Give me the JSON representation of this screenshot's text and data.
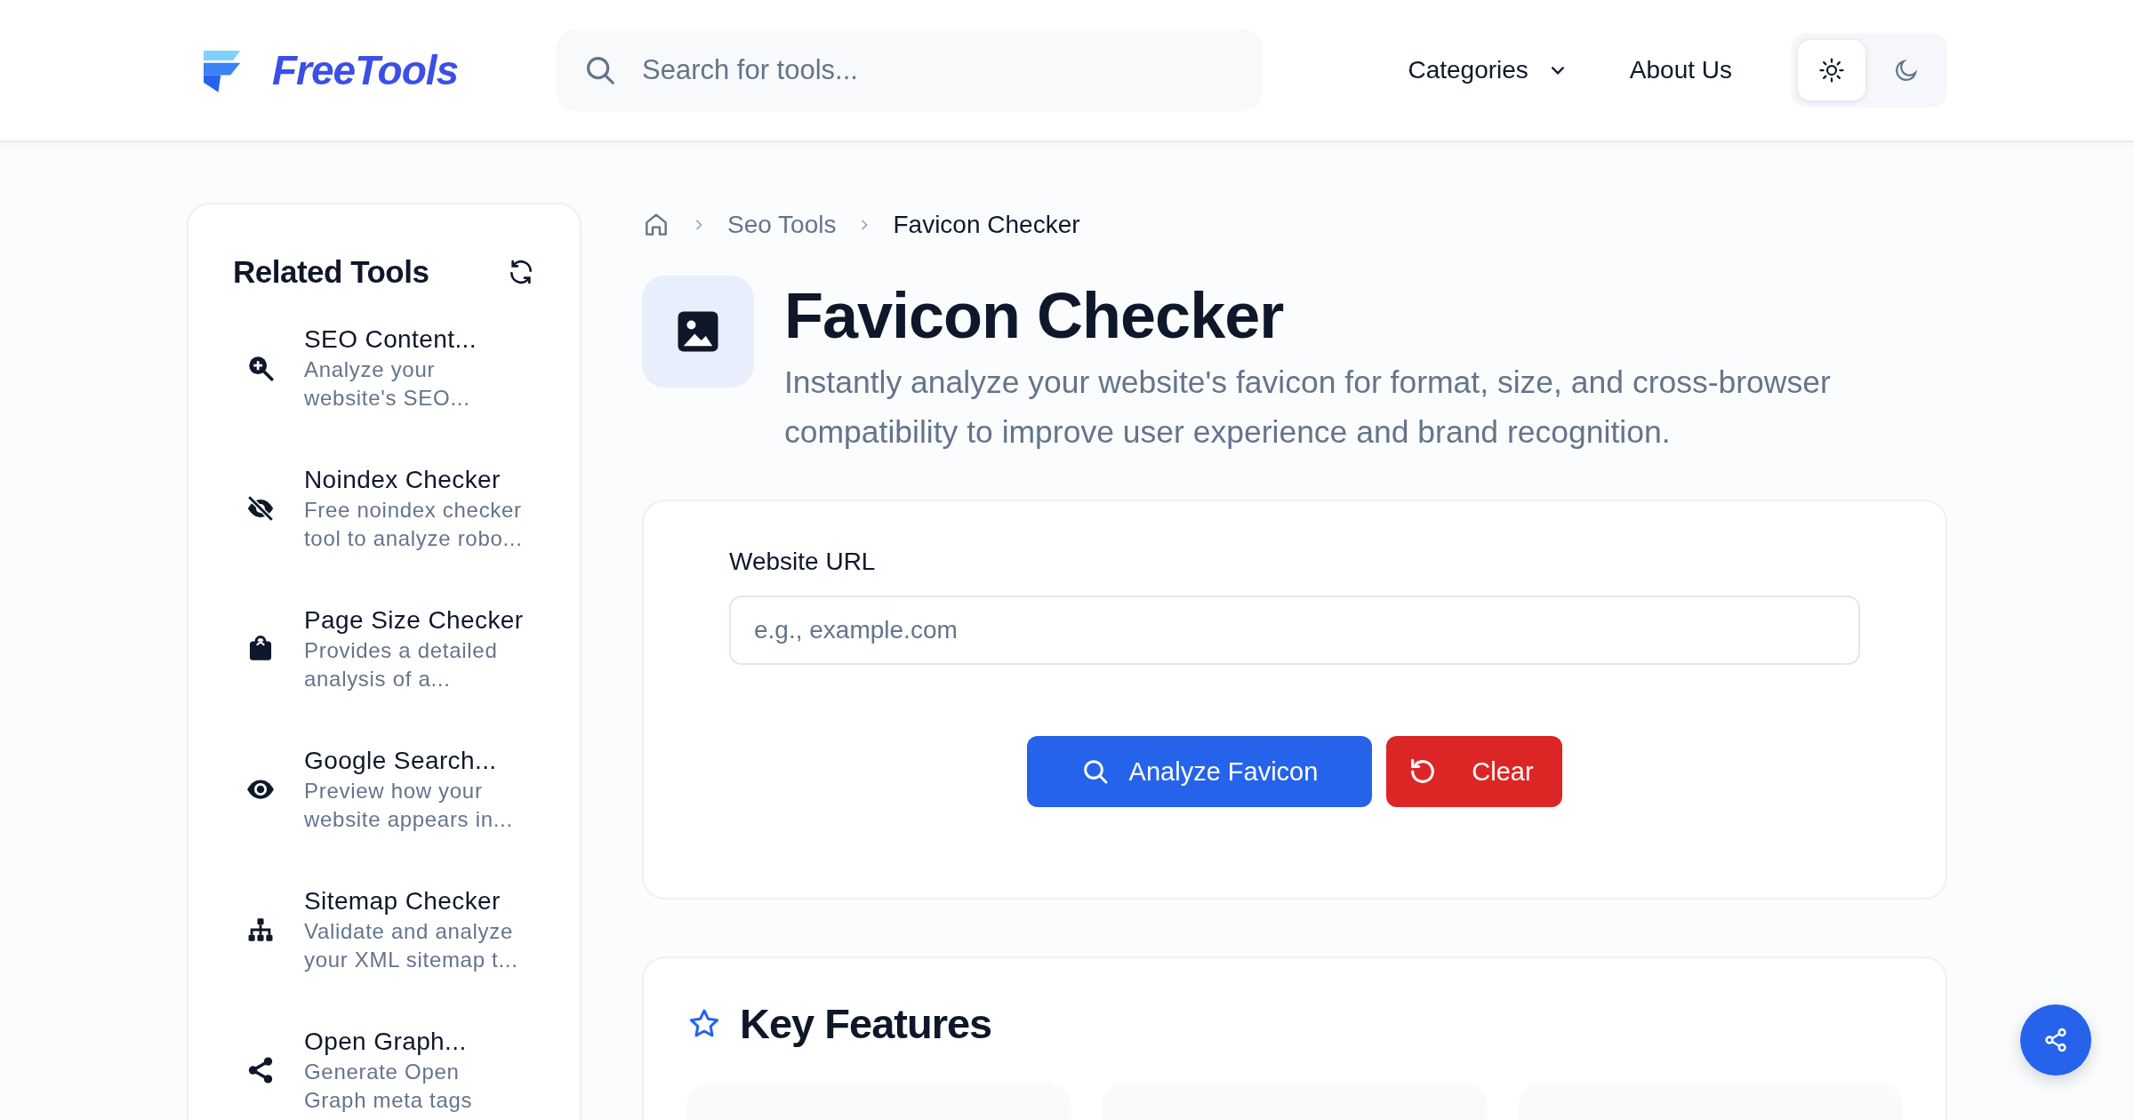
{
  "header": {
    "logo": "FreeTools",
    "search": {
      "placeholder": "Search for tools..."
    },
    "nav": [
      {
        "label": "Categories",
        "kind": "dropdown"
      },
      {
        "label": "About Us",
        "kind": "link"
      }
    ],
    "theme": [
      {
        "kind": "light",
        "selected": true
      },
      {
        "kind": "dark",
        "selected": false
      }
    ]
  },
  "sidebar": {
    "title": "Related Tools",
    "items": [
      {
        "kind": "zoom",
        "title": "SEO Content...",
        "description": "Analyze your website's SEO..."
      },
      {
        "kind": "eye-off",
        "title": "Noindex Checker",
        "description": "Free noindex checker tool to analyze robo..."
      },
      {
        "kind": "bag",
        "title": "Page Size Checker",
        "description": "Provides a detailed analysis of a..."
      },
      {
        "kind": "eye",
        "title": "Google Search...",
        "description": "Preview how your website appears in..."
      },
      {
        "kind": "sitemap",
        "title": "Sitemap Checker",
        "description": "Validate and analyze your XML sitemap t..."
      },
      {
        "kind": "share",
        "title": "Open Graph...",
        "description": "Generate Open Graph meta tags"
      }
    ]
  },
  "breadcrumb": [
    {
      "label": "Seo Tools",
      "current": false
    },
    {
      "label": "Favicon Checker",
      "current": true
    }
  ],
  "tool": {
    "title": "Favicon Checker",
    "description": "Instantly analyze your website's favicon for format, size, and cross-browser compatibility to improve user experience and brand recognition."
  },
  "form": {
    "label": "Website URL",
    "placeholder": "e.g., example.com",
    "buttons": [
      {
        "label": "Analyze Favicon",
        "kind": "primary"
      },
      {
        "label": "Clear",
        "kind": "danger"
      }
    ]
  },
  "features": {
    "title": "Key Features"
  }
}
